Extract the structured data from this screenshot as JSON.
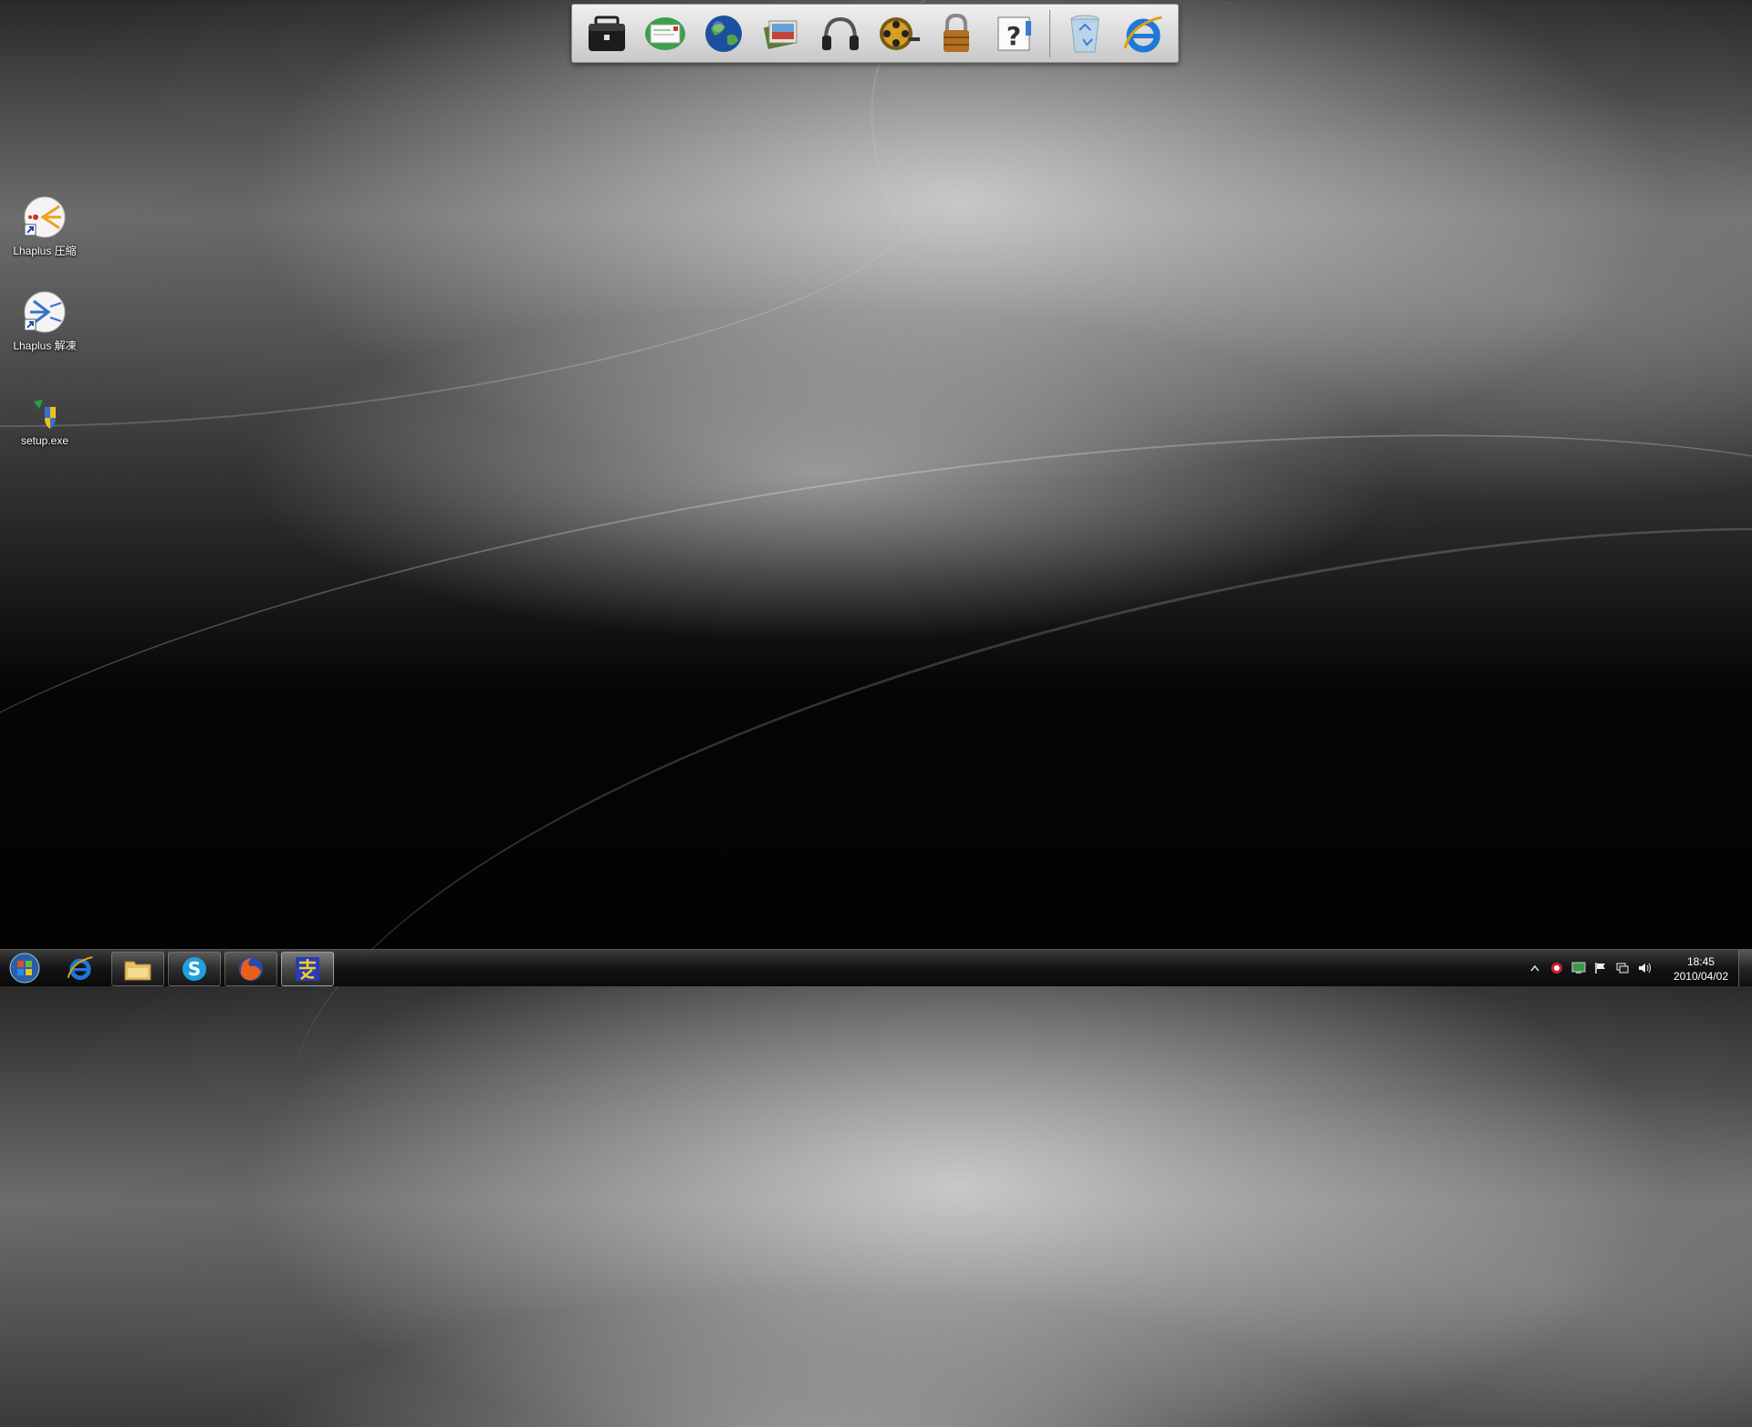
{
  "desktop": {
    "icons": [
      {
        "label": "Lhaplus 圧縮",
        "icon": "lhaplus-compress-icon"
      },
      {
        "label": "Lhaplus 解凍",
        "icon": "lhaplus-extract-icon"
      },
      {
        "label": "setup.exe",
        "icon": "setup-shield-icon"
      }
    ]
  },
  "dock": {
    "items": [
      {
        "icon": "briefcase-icon"
      },
      {
        "icon": "mail-icon"
      },
      {
        "icon": "globe-icon"
      },
      {
        "icon": "photos-icon"
      },
      {
        "icon": "headphones-icon"
      },
      {
        "icon": "film-reel-icon"
      },
      {
        "icon": "padlock-icon"
      },
      {
        "icon": "help-icon"
      },
      {
        "icon": "recycle-bin-icon"
      },
      {
        "icon": "internet-explorer-icon"
      }
    ]
  },
  "taskbar": {
    "buttons": [
      {
        "icon": "start-orb-icon"
      },
      {
        "icon": "internet-explorer-icon"
      },
      {
        "icon": "folder-icon"
      },
      {
        "icon": "skype-icon"
      },
      {
        "icon": "firefox-icon"
      },
      {
        "icon": "hidemaru-editor-icon"
      }
    ],
    "tray": {
      "icons": [
        "show-hidden-icons-arrow",
        "security-icon",
        "display-icon",
        "action-center-flag-icon",
        "network-icon",
        "volume-icon"
      ],
      "time": "18:45",
      "date": "2010/04/02"
    }
  },
  "colors": {
    "taskbar_bg": "#141414",
    "dock_bg": "#d8d8d8",
    "label_text": "#ffffff"
  }
}
